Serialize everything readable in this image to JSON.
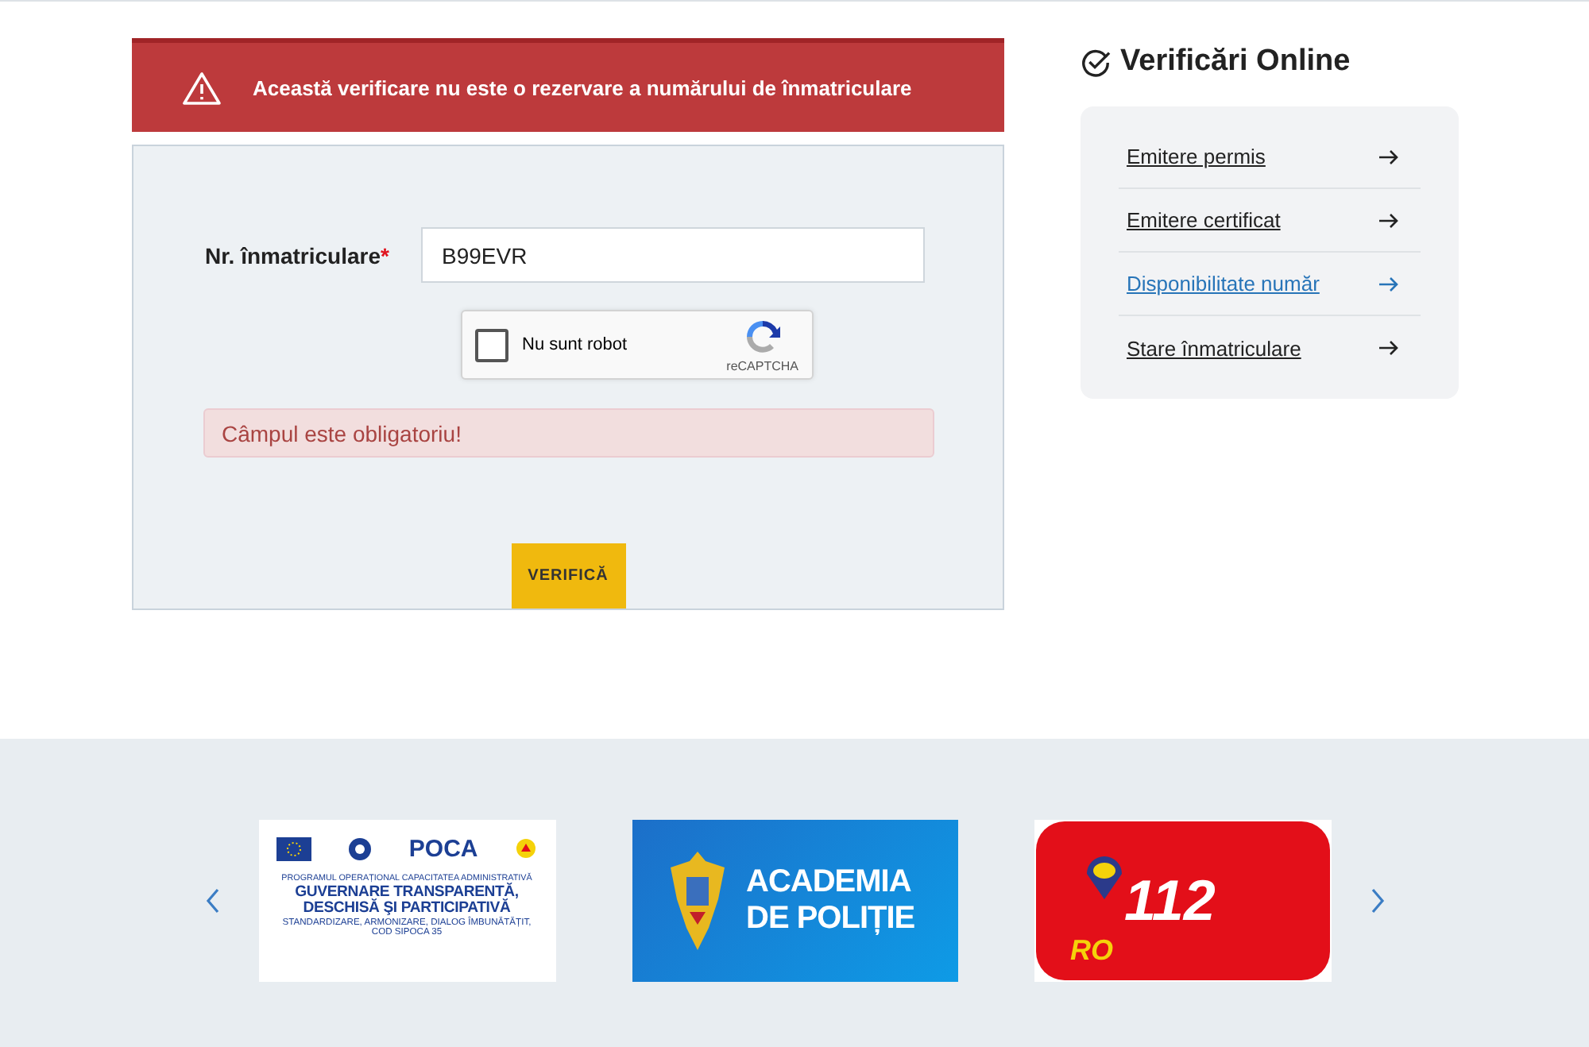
{
  "alert": {
    "text": "Această verificare nu este o rezervare a numărului de înmatriculare"
  },
  "form": {
    "label": "Nr. înmatriculare",
    "required_mark": "*",
    "value": "B99EVR",
    "captcha": {
      "label": "Nu sunt robot",
      "brand": "reCAPTCHA",
      "checked": false
    },
    "error": "Câmpul este obligatoriu!",
    "button": "VERIFICĂ"
  },
  "sidebar": {
    "title": "Verificări Online",
    "items": [
      {
        "label": "Emitere permis",
        "selected": false
      },
      {
        "label": "Emitere certificat",
        "selected": false
      },
      {
        "label": "Disponibilitate număr",
        "selected": true
      },
      {
        "label": "Stare înmatriculare",
        "selected": false
      }
    ]
  },
  "carousel": {
    "banners": [
      {
        "kind": "poca",
        "logo": "POCA",
        "lines": [
          "PROGRAMUL OPERAȚIONAL CAPACITATEA ADMINISTRATIVĂ",
          "GUVERNARE TRANSPARENTĂ,",
          "DESCHISĂ ŞI PARTICIPATIVĂ",
          "STANDARDIZARE, ARMONIZARE, DIALOG ÎMBUNĂTĂȚIT,",
          "COD SIPOCA 35"
        ]
      },
      {
        "kind": "academia",
        "lines": [
          "ACADEMIA",
          "DE POLIȚIE"
        ]
      },
      {
        "kind": "emergency",
        "lines": [
          "112",
          "RO"
        ]
      }
    ]
  }
}
